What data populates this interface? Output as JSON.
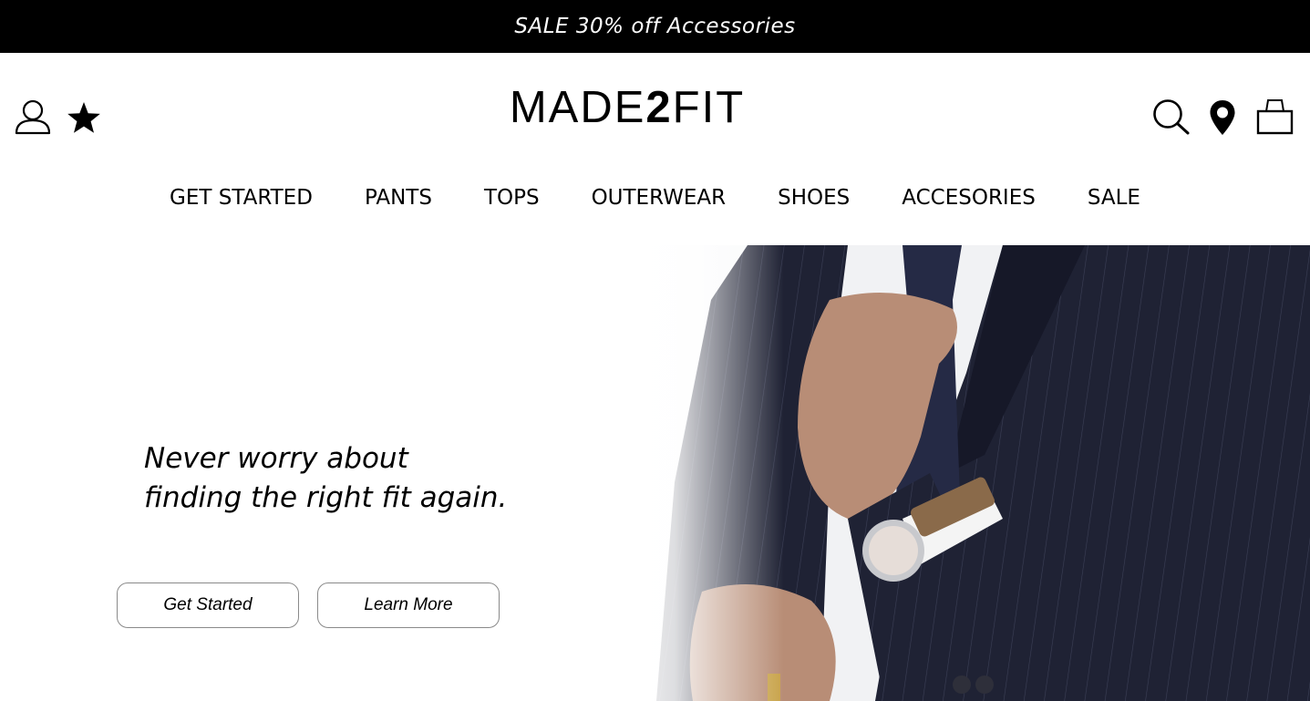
{
  "promo": {
    "text": "SALE 30% off Accessories"
  },
  "header": {
    "logo_regular": "MADE",
    "logo_bold": "2",
    "logo_rest": "FIT",
    "left_icons": [
      "user-icon",
      "star-icon"
    ],
    "right_icons": [
      "search-icon",
      "location-pin-icon",
      "shopping-bag-icon"
    ]
  },
  "nav": {
    "items": [
      {
        "label": "GET STARTED"
      },
      {
        "label": "PANTS"
      },
      {
        "label": "TOPS"
      },
      {
        "label": "OUTERWEAR"
      },
      {
        "label": "SHOES"
      },
      {
        "label": "ACCESORIES"
      },
      {
        "label": "SALE"
      }
    ]
  },
  "hero": {
    "headline_line1": "Never worry about",
    "headline_line2": "finding the right fit again.",
    "get_started_label": "Get Started",
    "learn_more_label": "Learn More"
  },
  "colors": {
    "promo_bg": "#000000",
    "promo_text": "#ffffff",
    "button_border": "#8a8a8a",
    "suit_navy": "#1f2234"
  }
}
